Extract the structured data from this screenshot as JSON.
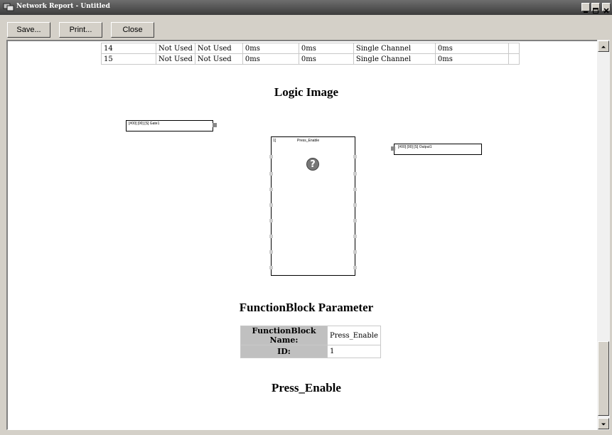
{
  "window": {
    "title": "Network Report - Untitled"
  },
  "toolbar": {
    "save_label": "Save...",
    "print_label": "Print...",
    "close_label": "Close"
  },
  "channel_table": {
    "rows": [
      [
        "14",
        "Not Used",
        "Not Used",
        "0ms",
        "0ms",
        "Single Channel",
        "0ms",
        ""
      ],
      [
        "15",
        "Not Used",
        "Not Used",
        "0ms",
        "0ms",
        "Single Channel",
        "0ms",
        ""
      ]
    ]
  },
  "logic_image": {
    "heading": "Logic Image",
    "input_block_label": "[#00] [00] [S] Gate1",
    "function_block_index": "1]",
    "function_block_name": "Press_Enable",
    "output_block_label": "[#00] [00] [S] Output1",
    "help_icon_glyph": "?"
  },
  "function_block_parameter": {
    "heading": "FunctionBlock Parameter",
    "name_label": "FunctionBlock Name:",
    "name_value": "Press_Enable",
    "id_label": "ID:",
    "id_value": "1"
  },
  "section_footer": {
    "heading": "Press_Enable"
  },
  "icons": {
    "app": "network-report-app-icon",
    "minimize": "minimize-icon",
    "maximize": "maximize-icon",
    "close": "close-icon",
    "scroll_up": "scroll-up-arrow-icon",
    "scroll_down": "scroll-down-arrow-icon",
    "help": "question-mark-icon"
  }
}
